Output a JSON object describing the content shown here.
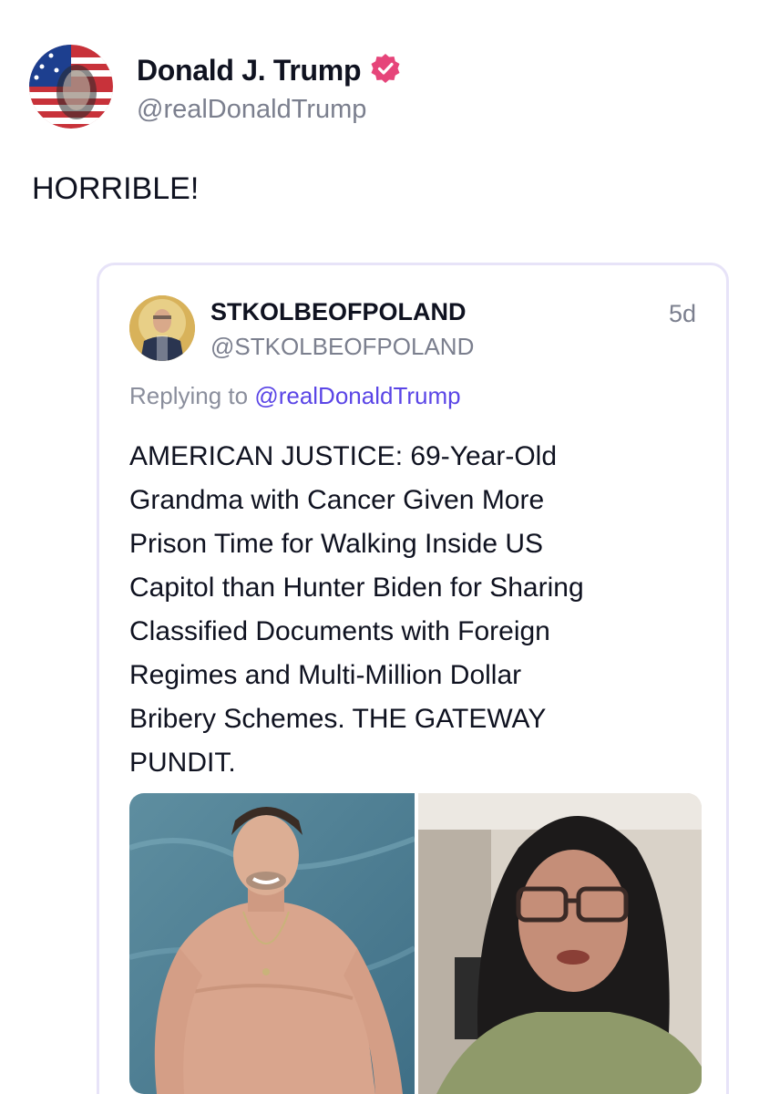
{
  "post": {
    "author_name": "Donald J. Trump",
    "author_handle": "@realDonaldTrump",
    "verified": true,
    "text": "HORRIBLE!"
  },
  "quote": {
    "author_name": "STKOLBEOFPOLAND",
    "author_handle": "@STKOLBEOFPOLAND",
    "time": "5d",
    "replying_prefix": "Replying to",
    "replying_mention": "@realDonaldTrump",
    "text_lines": [
      "AMERICAN JUSTICE: 69-Year-Old",
      "Grandma with Cancer Given More",
      "Prison Time for Walking Inside US",
      "Capitol than Hunter Biden for Sharing",
      "Classified Documents with Foreign",
      "Regimes and Multi-Million Dollar",
      "Bribery Schemes. THE GATEWAY",
      "PUNDIT."
    ]
  },
  "colors": {
    "verified_badge": "#e6457a",
    "mention": "#5a45e6",
    "card_border": "#e7e3f8"
  },
  "icons": {
    "verified": "verified-badge-icon"
  }
}
